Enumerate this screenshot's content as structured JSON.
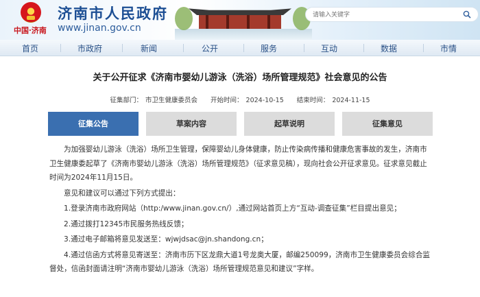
{
  "header": {
    "site_title": "济南市人民政府",
    "site_url": "www.jinan.gov.cn",
    "cn_mark": "中国·济南",
    "search_placeholder": "请输入关键字"
  },
  "nav": {
    "items": [
      "首页",
      "市政府",
      "新闻",
      "公开",
      "服务",
      "互动",
      "数据",
      "市情"
    ]
  },
  "article": {
    "title": "关于公开征求《济南市婴幼儿游泳（洗浴）场所管理规范》社会意见的公告",
    "meta": {
      "dept_label": "征集部门：",
      "dept_value": "市卫生健康委员会",
      "start_label": "开始时间：",
      "start_value": "2024-10-15",
      "end_label": "结束时间：",
      "end_value": "2024-11-15"
    }
  },
  "tabs": [
    {
      "label": "征集公告",
      "active": true
    },
    {
      "label": "草案内容",
      "active": false
    },
    {
      "label": "起草说明",
      "active": false
    },
    {
      "label": "征集意见",
      "active": false
    }
  ],
  "content": {
    "p1": "为加强婴幼儿游泳（洗浴）场所卫生管理，保障婴幼儿身体健康，防止传染病传播和健康危害事故的发生，济南市卫生健康委起草了《济南市婴幼儿游泳（洗浴）场所管理规范》（征求意见稿），现向社会公开征求意见。征求意见截止时间为2024年11月15日。",
    "p2": "意见和建议可以通过下列方式提出：",
    "p3": "1.登录济南市政府网站（http:/www.jinan.gov.cn/）,通过网站首页上方“互动-调查征集”栏目提出意见；",
    "p4": "2.通过拨打12345市民服务热线反馈；",
    "p5": "3.通过电子邮箱将意见发送至：wjwjdsac@jn.shandong.cn；",
    "p6": "4.通过信函方式将意见寄送至：济南市历下区龙鼎大道1号龙奥大厦，邮编250099，济南市卫生健康委员会综合监督处，信函封面请注明“济南市婴幼儿游泳（洗浴）场所管理规范意见和建议”字样。"
  }
}
